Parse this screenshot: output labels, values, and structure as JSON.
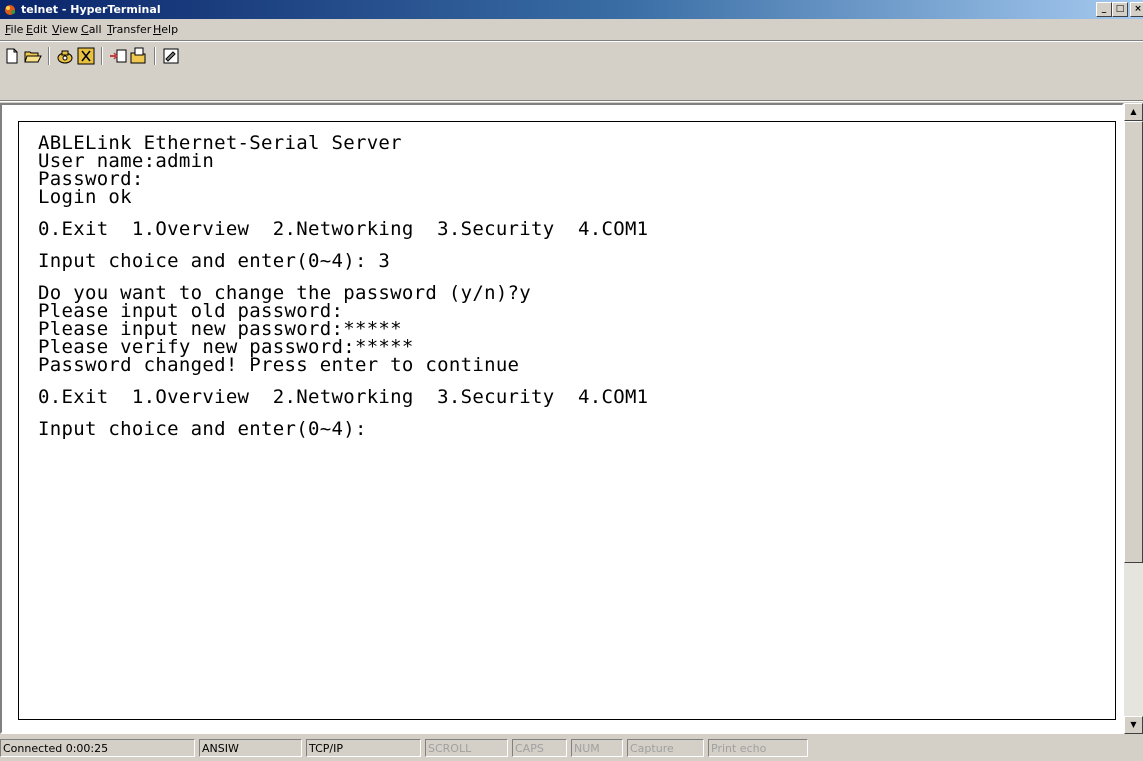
{
  "window": {
    "title": "telnet - HyperTerminal"
  },
  "menu": [
    {
      "key": "F",
      "rest": "ile"
    },
    {
      "key": "E",
      "rest": "dit"
    },
    {
      "key": "V",
      "rest": "iew"
    },
    {
      "key": "C",
      "rest": "all"
    },
    {
      "key": "T",
      "rest": "ransfer"
    },
    {
      "key": "H",
      "rest": "elp"
    }
  ],
  "toolbar": {
    "icons": [
      "new-connection-icon",
      "open-icon",
      "call-icon",
      "disconnect-icon",
      "send-icon",
      "receive-icon",
      "properties-icon"
    ]
  },
  "terminal": {
    "lines": [
      "ABLELink Ethernet-Serial Server",
      "User name:admin",
      "Password:",
      "Login ok",
      "",
      "0.Exit  1.Overview  2.Networking  3.Security  4.COM1",
      "",
      "Input choice and enter(0~4): 3",
      "",
      "Do you want to change the password (y/n)?y",
      "Please input old password:",
      "Please input new password:*****",
      "Please verify new password:*****",
      "Password changed! Press enter to continue",
      "",
      "0.Exit  1.Overview  2.Networking  3.Security  4.COM1",
      "",
      "Input choice and enter(0~4):"
    ]
  },
  "status": {
    "connected": "Connected 0:00:25",
    "emulation": "ANSIW",
    "protocol": "TCP/IP",
    "scroll": "SCROLL",
    "caps": "CAPS",
    "num": "NUM",
    "capture": "Capture",
    "print_echo": "Print echo"
  },
  "colors": {
    "titlebar_start": "#0a246a",
    "titlebar_end": "#a6caf0",
    "chrome": "#d4d0c8"
  }
}
